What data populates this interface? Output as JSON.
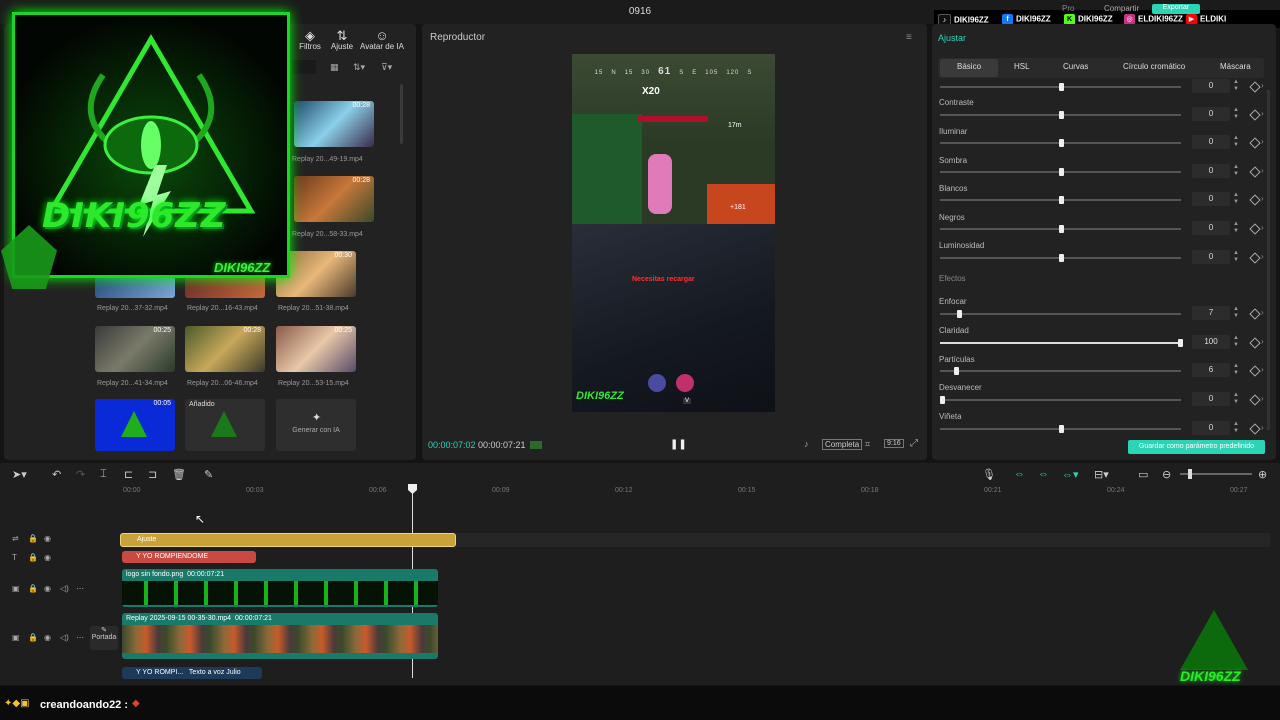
{
  "window": {
    "title": "0916"
  },
  "media": {
    "tools": [
      {
        "label": "Filtros",
        "icon": "filters-icon"
      },
      {
        "label": "Ajuste",
        "icon": "adjust-icon"
      },
      {
        "label": "Avatar de IA",
        "icon": "ai-avatar-icon"
      }
    ],
    "items": [
      {
        "label": "Replay 20...49-19.mp4",
        "duration": "00:28"
      },
      {
        "label": "Replay 20...58-33.mp4",
        "duration": "00:28"
      },
      {
        "label": "Replay 20...37-32.mp4",
        "duration": ""
      },
      {
        "label": "Replay 20...16-43.mp4",
        "duration": ""
      },
      {
        "label": "Replay 20...51-38.mp4",
        "duration": "00:30"
      },
      {
        "label": "Replay 20...41-34.mp4",
        "duration": "00:25"
      },
      {
        "label": "Replay 20...06-46.mp4",
        "duration": "00:28"
      },
      {
        "label": "Replay 20...53-15.mp4",
        "duration": "00:25"
      },
      {
        "label": "",
        "duration": "00:05"
      },
      {
        "label": "",
        "badge": "Añadido"
      }
    ],
    "generate_ai": "Generar con IA"
  },
  "overlay": {
    "logo_text": "DIKI96ZZ",
    "logo_tag": "DIKI96ZZ"
  },
  "player": {
    "title": "Reproductor",
    "current_time": "00:00:07:02",
    "total_time": "00:00:07:21",
    "full_label": "Completa",
    "ratio_label": "9:16",
    "hud": {
      "compass": [
        "15",
        "N",
        "15",
        "30",
        "61",
        "S",
        "E",
        "105",
        "120",
        "S"
      ],
      "kill_count": "X20",
      "distance": "17m",
      "damage": "+181",
      "warning": "Necesitas recargar",
      "key": "V",
      "watermark": "DIKI96ZZ"
    }
  },
  "props": {
    "header": "Ajustar",
    "tabs": [
      "Básico",
      "HSL",
      "Curvas",
      "Círculo cromático",
      "Máscara"
    ],
    "section_effects": "Efectos",
    "rows": [
      {
        "label": "",
        "value": "0",
        "level": 0.5
      },
      {
        "label": "Contraste",
        "value": "0",
        "level": 0.5
      },
      {
        "label": "Iluminar",
        "value": "0",
        "level": 0.5
      },
      {
        "label": "Sombra",
        "value": "0",
        "level": 0.5
      },
      {
        "label": "Blancos",
        "value": "0",
        "level": 0.5
      },
      {
        "label": "Negros",
        "value": "0",
        "level": 0.5
      },
      {
        "label": "Luminosidad",
        "value": "0",
        "level": 0.5
      },
      {
        "label": "Enfocar",
        "value": "7",
        "level": 0.07
      },
      {
        "label": "Claridad",
        "value": "100",
        "level": 1.0
      },
      {
        "label": "Partículas",
        "value": "6",
        "level": 0.06
      },
      {
        "label": "Desvanecer",
        "value": "0",
        "level": 0.0
      },
      {
        "label": "Viñeta",
        "value": "0",
        "level": 0.5
      }
    ],
    "save_button": "Guardar como parámetro predefinido"
  },
  "topright": {
    "compartir": "Compartir",
    "exportar": "Exportar",
    "pro": "Pro"
  },
  "social": [
    {
      "name": "DIKI96ZZ",
      "icon": "tiktok-icon",
      "color": "#111111"
    },
    {
      "name": "DIKI96ZZ",
      "icon": "facebook-icon",
      "color": "#1877f2"
    },
    {
      "name": "DIKI96ZZ",
      "icon": "kick-icon",
      "color": "#53fc18"
    },
    {
      "name": "ELDIKI96ZZ",
      "icon": "instagram-icon",
      "color": "#c13584"
    },
    {
      "name": "ELDIKI",
      "icon": "youtube-icon",
      "color": "#ff0000"
    }
  ],
  "timeline": {
    "ruler": [
      "00:00",
      "00:03",
      "00:06",
      "00:09",
      "00:12",
      "00:15",
      "00:18",
      "00:21",
      "00:24",
      "00:27"
    ],
    "adjust_clip": "Ajuste",
    "text_clip": "Y YO ROMPIENDOME",
    "logo_clip": {
      "name": "logo sin fondo.png",
      "time": "00:00:07:21"
    },
    "video_clip": {
      "name": "Replay 2025-09-15 00-35-30.mp4",
      "time": "00:00:07:21"
    },
    "tts_clip": {
      "name": "Y YO ROMPI...",
      "extra": "Texto a voz Julio"
    },
    "cover_label": "Portada"
  },
  "chat": {
    "user": "creandoando22 :"
  },
  "colors": {
    "accent": "#2bd4b5",
    "adjust_clip": "#c9a23a",
    "text_clip": "#c94a43",
    "media_clip": "#1a7a6a",
    "logo_green": "#22dd22"
  }
}
